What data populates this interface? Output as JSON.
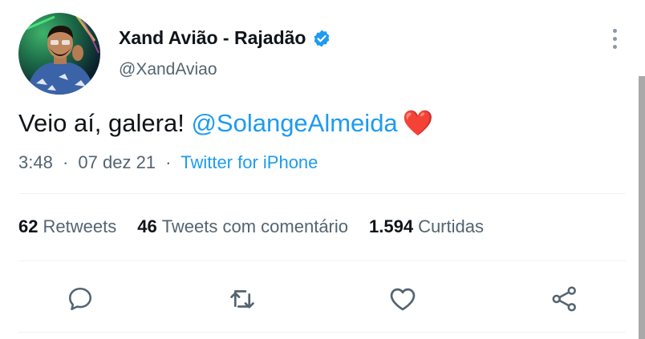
{
  "tweet": {
    "display_name": "Xand Avião - Rajadão",
    "handle": "@XandAviao",
    "text_prefix": "Veio aí, galera! ",
    "mention": "@SolangeAlmeida",
    "emoji": "❤️",
    "time": "3:48",
    "date": "07 dez 21",
    "separator": "·",
    "source": "Twitter for iPhone"
  },
  "stats": {
    "retweets_count": "62",
    "retweets_label": "Retweets",
    "quotes_count": "46",
    "quotes_label": "Tweets com comentário",
    "likes_count": "1.594",
    "likes_label": "Curtidas"
  },
  "icons": {
    "verified": "verified-badge-icon",
    "more": "more-vertical-icon",
    "reply": "reply-icon",
    "retweet": "retweet-icon",
    "like": "heart-icon",
    "share": "share-icon"
  },
  "colors": {
    "accent": "#1d9bf0",
    "text": "#0f1419",
    "secondary": "#536471",
    "heart": "#e0245e"
  }
}
